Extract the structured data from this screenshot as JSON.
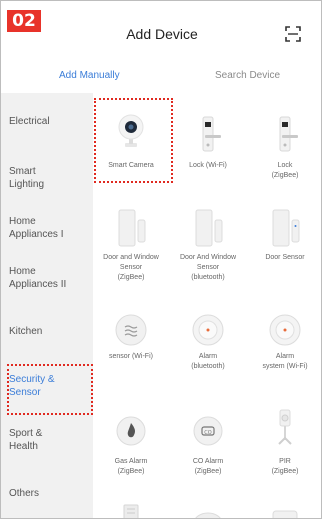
{
  "step_badge": "02",
  "header": {
    "title": "Add Device",
    "scan_icon": "scan-frame-icon"
  },
  "tabs": {
    "manual": "Add Manually",
    "search": "Search Device"
  },
  "sidebar": {
    "items": [
      {
        "label": "Electrical"
      },
      {
        "label": "Smart\nLighting"
      },
      {
        "label": "Home\nAppliances I"
      },
      {
        "label": "Home\nAppliances II"
      },
      {
        "label": "Kitchen"
      },
      {
        "label": "Security &\nSensor"
      },
      {
        "label": "Sport &\nHealth"
      },
      {
        "label": "Others"
      }
    ],
    "selected_index": 5
  },
  "devices": [
    {
      "label": "Smart Camera",
      "icon": "camera-icon"
    },
    {
      "label": "Lock (Wi-Fi)",
      "icon": "door-lock-icon"
    },
    {
      "label": "Lock\n(ZigBee)",
      "icon": "door-lock-icon"
    },
    {
      "label": "Door and Window\nSensor\n(ZigBee)",
      "icon": "door-sensor-icon"
    },
    {
      "label": "Door And Window\nSensor\n(bluetooth)",
      "icon": "door-sensor-icon"
    },
    {
      "label": "Door Sensor",
      "icon": "door-sensor-icon"
    },
    {
      "label": "sensor (Wi-Fi)",
      "icon": "sensor-icon"
    },
    {
      "label": "Alarm\n(bluetooth)",
      "icon": "alarm-icon"
    },
    {
      "label": "Alarm\nsystem (Wi-Fi)",
      "icon": "alarm-icon"
    },
    {
      "label": "Gas Alarm\n(ZigBee)",
      "icon": "gas-alarm-icon"
    },
    {
      "label": "CO Alarm\n(ZigBee)",
      "icon": "co-alarm-icon"
    },
    {
      "label": "PIR\n(ZigBee)",
      "icon": "pir-sensor-icon"
    }
  ],
  "colors": {
    "accent": "#3b7dd8",
    "highlight": "#e02a20",
    "badge": "#e8332a"
  }
}
